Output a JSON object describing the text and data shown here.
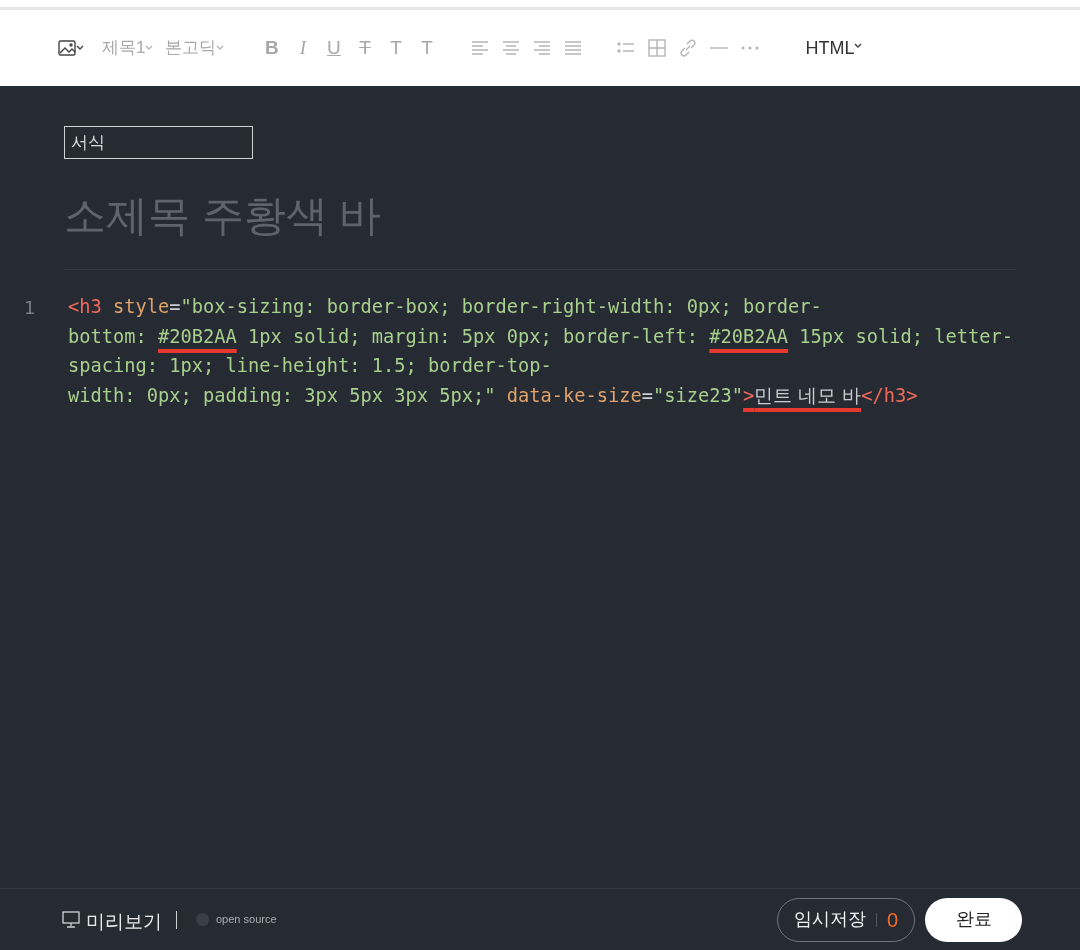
{
  "toolbar": {
    "items": [
      {
        "kind": "image",
        "disabled": false
      },
      {
        "kind": "dropdown",
        "label": "제목1",
        "disabled": true
      },
      {
        "kind": "dropdown",
        "label": "본고딕",
        "disabled": true
      },
      {
        "kind": "bold",
        "label": "B",
        "disabled": true
      },
      {
        "kind": "italic",
        "label": "I",
        "disabled": true
      },
      {
        "kind": "underline",
        "label": "U",
        "disabled": true
      },
      {
        "kind": "strike",
        "label": "T",
        "disabled": true
      },
      {
        "kind": "plain",
        "label": "T",
        "disabled": true
      },
      {
        "kind": "plain",
        "label": "T",
        "disabled": true
      },
      {
        "kind": "align-left",
        "disabled": true
      },
      {
        "kind": "align-center",
        "disabled": true
      },
      {
        "kind": "align-right",
        "disabled": true
      },
      {
        "kind": "align-justify",
        "disabled": true
      },
      {
        "kind": "list",
        "disabled": true
      },
      {
        "kind": "table",
        "disabled": true
      },
      {
        "kind": "link",
        "disabled": true
      },
      {
        "kind": "rule",
        "disabled": true
      },
      {
        "kind": "more",
        "disabled": true
      }
    ],
    "mode": {
      "label": "HTML"
    }
  },
  "category": {
    "value": "서식"
  },
  "title": {
    "value": "소제목 주황색 바"
  },
  "code": {
    "line_number": "1",
    "lines": [
      [
        {
          "kind": "tag",
          "text": "<h3"
        },
        {
          "kind": "attr",
          "text": "style"
        },
        {
          "kind": "punct",
          "text": "="
        },
        {
          "kind": "string",
          "text": "\"box-sizing: border-box; border-right-width: 0px; border-"
        }
      ],
      [
        {
          "kind": "string",
          "text": "bottom: "
        },
        {
          "kind": "string",
          "text": "#20B2AA",
          "underlined": true
        },
        {
          "kind": "string",
          "text": " 1px solid; margin: 5px 0px; border-left: "
        },
        {
          "kind": "string",
          "text": "#20B2AA",
          "underlined": true
        },
        {
          "kind": "string",
          "text": " 15px solid; letter-"
        }
      ],
      [
        {
          "kind": "string",
          "text": "spacing: 1px; line-height: 1.5; border-top-"
        }
      ],
      [
        {
          "kind": "string",
          "text": "width: 0px; padding: 3px 5px 3px 5px;\""
        },
        {
          "kind": "attr",
          "text": "data-ke-size"
        },
        {
          "kind": "punct",
          "text": "="
        },
        {
          "kind": "string",
          "text": "\"size23\""
        },
        {
          "kind": "tag",
          "text": ">",
          "underlined": true
        },
        {
          "kind": "text",
          "text": "민트 네모 바",
          "underlined": true
        },
        {
          "kind": "tag",
          "text": "</h3>"
        }
      ]
    ]
  },
  "footer": {
    "preview": "미리보기",
    "open_source": "open source",
    "draft": {
      "label": "임시저장",
      "count": "0"
    },
    "done": "완료"
  }
}
